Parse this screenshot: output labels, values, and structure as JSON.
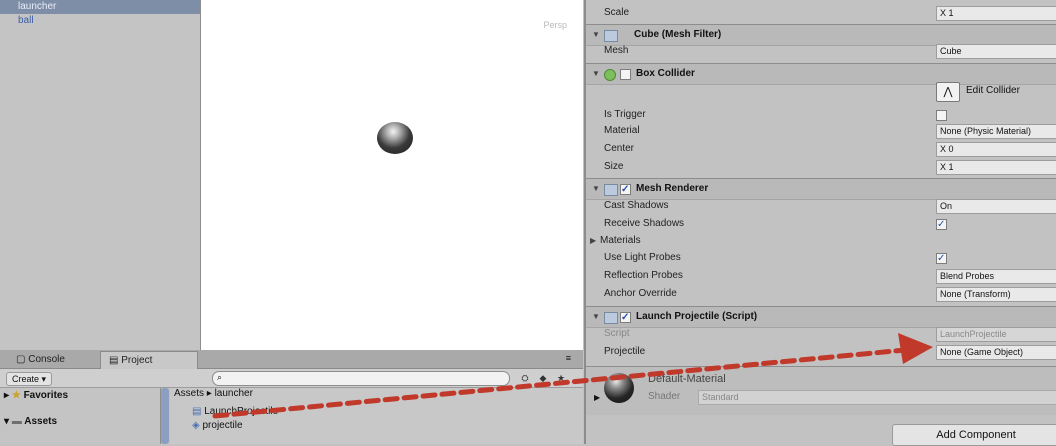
{
  "hierarchy": {
    "items": [
      {
        "label": "launcher",
        "selected": true
      },
      {
        "label": "ball",
        "selected": false
      }
    ]
  },
  "scene": {
    "label": "Persp"
  },
  "bottom_tabs": [
    {
      "label": "Console",
      "icon": "console-icon"
    },
    {
      "label": "Project",
      "icon": "project-icon"
    }
  ],
  "project": {
    "create_label": "Create ▾",
    "search_placeholder": "",
    "folders": [
      {
        "label": "Favorites",
        "icon": "star-folder-icon"
      },
      {
        "label": "Assets",
        "icon": "folder-icon"
      }
    ],
    "folders_extra": "",
    "breadcrumb": "Assets ▸ launcher",
    "assets": [
      {
        "label": "LaunchProjectile",
        "icon": "script-icon"
      },
      {
        "label": "projectile",
        "icon": "prefab-icon"
      }
    ]
  },
  "inspector": {
    "scale": {
      "label": "Scale",
      "value": "X 1"
    },
    "mesh_filter": {
      "title": "Cube (Mesh Filter)",
      "mesh_label": "Mesh",
      "mesh_value": "Cube"
    },
    "box_collider": {
      "title": "Box Collider",
      "edit_collider": "Edit Collider",
      "rows": [
        {
          "label": "Is Trigger",
          "kind": "check",
          "checked": false
        },
        {
          "label": "Material",
          "kind": "value",
          "value": "None (Physic Material)"
        },
        {
          "label": "Center",
          "kind": "value",
          "value": "X 0"
        },
        {
          "label": "Size",
          "kind": "value",
          "value": "X 1"
        }
      ]
    },
    "mesh_renderer": {
      "title": "Mesh Renderer",
      "rows": [
        {
          "label": "Cast Shadows",
          "kind": "value",
          "value": "On"
        },
        {
          "label": "Receive Shadows",
          "kind": "check",
          "checked": true
        },
        {
          "label": "Materials",
          "kind": "fold"
        },
        {
          "label": "Use Light Probes",
          "kind": "check",
          "checked": true
        },
        {
          "label": "Reflection Probes",
          "kind": "value",
          "value": "Blend Probes"
        },
        {
          "label": "Anchor Override",
          "kind": "value",
          "value": "None (Transform)"
        }
      ]
    },
    "launch_projectile": {
      "title": "Launch Projectile (Script)",
      "script_label": "Script",
      "script_value": "LaunchProjectile",
      "projectile_label": "Projectile",
      "projectile_value": "None (Game Object)"
    },
    "material": {
      "name": "Default-Material",
      "shader_label": "Shader",
      "shader_value": "Standard"
    },
    "add_component": "Add Component"
  },
  "colors": {
    "drag_arrow": "#c0392b",
    "selection": "#7d8ea6"
  }
}
